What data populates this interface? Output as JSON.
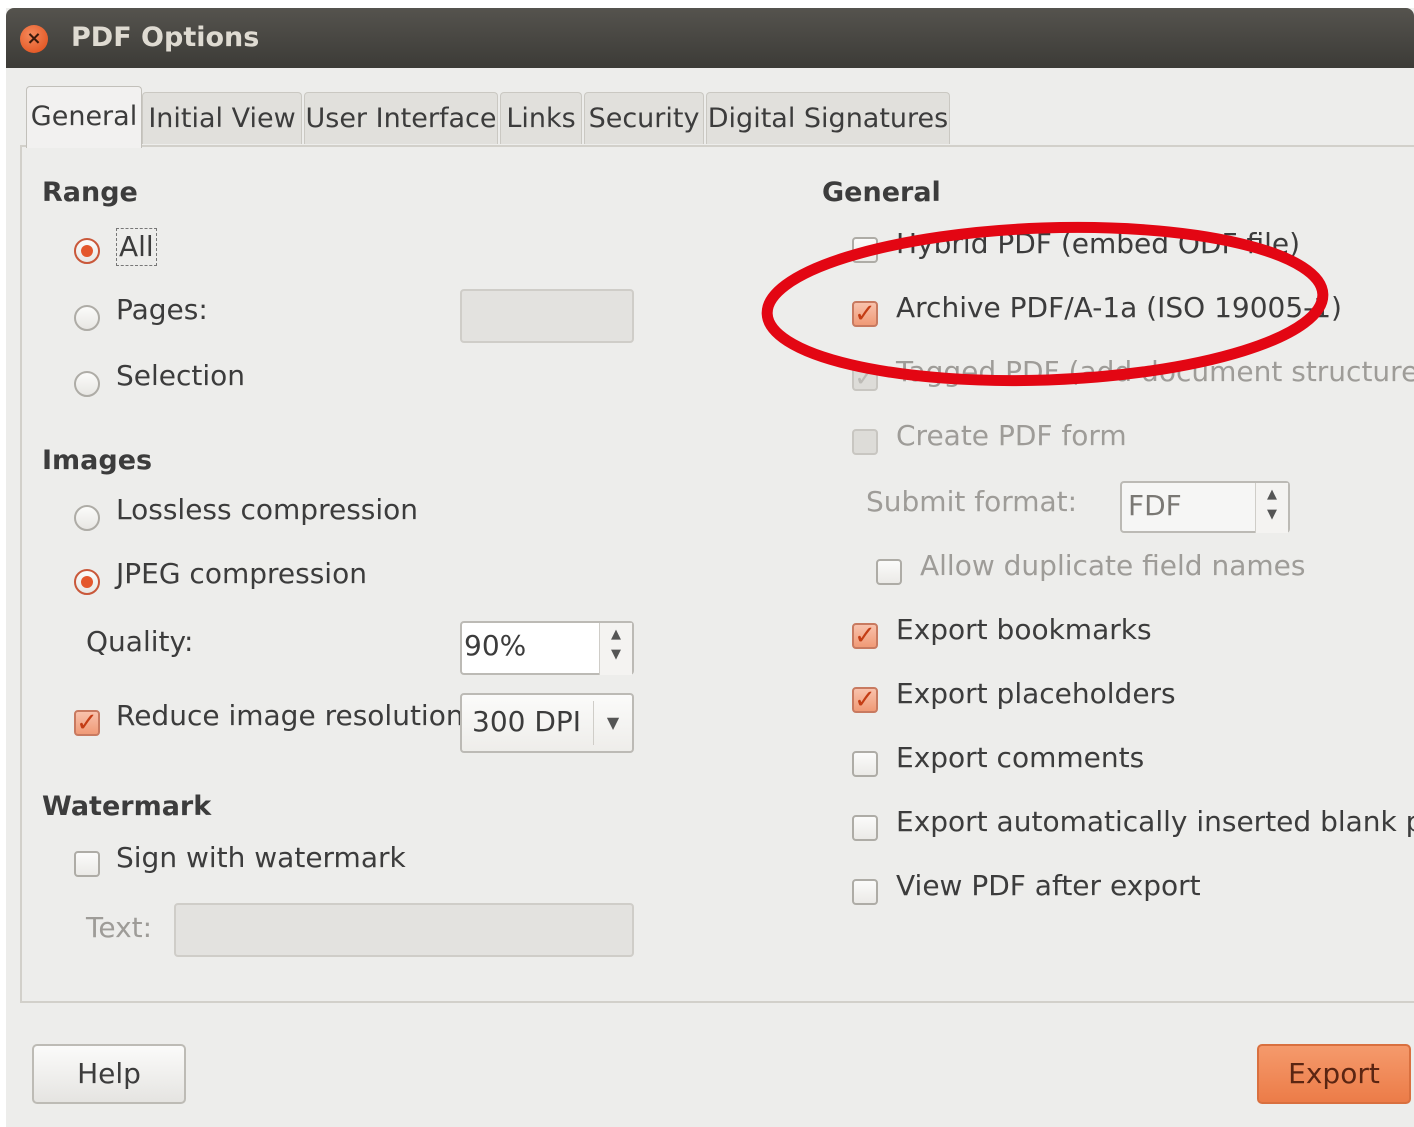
{
  "window": {
    "title": "PDF Options",
    "close_icon": "close-icon"
  },
  "tabs": [
    {
      "label": "General"
    },
    {
      "label": "Initial View"
    },
    {
      "label": "User Interface"
    },
    {
      "label": "Links"
    },
    {
      "label": "Security"
    },
    {
      "label": "Digital Signatures"
    }
  ],
  "range": {
    "heading": "Range",
    "all_label": "All",
    "pages_label": "Pages:",
    "pages_value": "",
    "selection_label": "Selection",
    "selected": "All"
  },
  "images": {
    "heading": "Images",
    "lossless_label": "Lossless compression",
    "jpeg_label": "JPEG compression",
    "selected": "JPEG compression",
    "quality_label": "Quality:",
    "quality_value": "90%",
    "reduce_label": "Reduce image resolution",
    "reduce_checked": true,
    "resolution_value": "300 DPI"
  },
  "watermark": {
    "heading": "Watermark",
    "sign_label": "Sign with watermark",
    "sign_checked": false,
    "text_label": "Text:",
    "text_value": ""
  },
  "general": {
    "heading": "General",
    "hybrid_label": "Hybrid PDF (embed ODF file)",
    "archive_label": "Archive PDF/A-1a (ISO 19005-1)",
    "tagged_label": "Tagged PDF (add document structure)",
    "create_form_label": "Create PDF form",
    "submit_format_label": "Submit format:",
    "submit_format_value": "FDF",
    "allow_duplicate_label": "Allow duplicate field names",
    "export_bookmarks_label": "Export bookmarks",
    "export_placeholders_label": "Export placeholders",
    "export_comments_label": "Export comments",
    "export_blank_pages_label": "Export automatically inserted blank pages",
    "view_after_label": "View PDF after export"
  },
  "buttons": {
    "help_label": "Help",
    "export_label": "Export"
  },
  "colors": {
    "accent": "#e4572c",
    "annotation": "#e30613",
    "title_bar": "#3c3b37"
  }
}
